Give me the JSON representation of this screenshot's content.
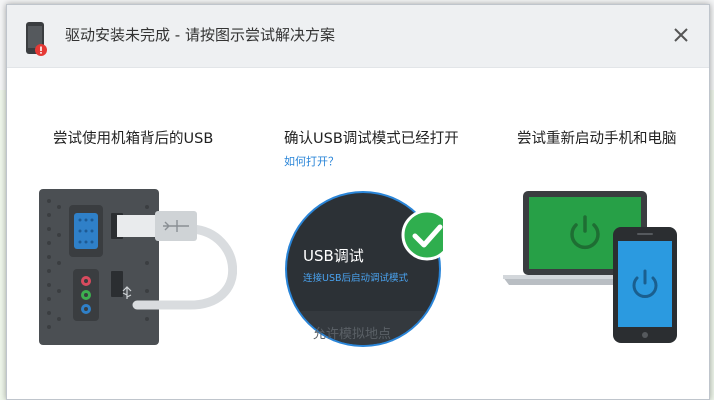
{
  "dialog": {
    "title": "驱动安装未完成 - 请按图示尝试解决方案"
  },
  "steps": [
    {
      "title": "尝试使用机箱背后的USB"
    },
    {
      "title": "确认USB调试模式已经打开",
      "link": "如何打开？"
    },
    {
      "title": "尝试重新启动手机和电脑"
    }
  ],
  "usb_debug_panel": {
    "heading": "USB调试",
    "subtext": "连接USB后启动调试模式",
    "faded_text": "允许模拟地点"
  },
  "colors": {
    "accent_blue": "#2a85d8",
    "check_green": "#2fae4e",
    "laptop_green": "#27a047",
    "phone_blue": "#2b9ae0",
    "panel_dark": "#2c3136"
  },
  "icons": [
    "phone-alert-icon",
    "close-icon",
    "power-icon",
    "check-icon",
    "usb-symbol-icon"
  ]
}
